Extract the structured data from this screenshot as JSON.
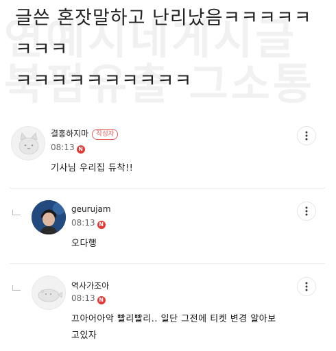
{
  "post": {
    "text": "글쓴 혼잣말하고 난리났음ㅋㅋㅋㅋㅋㅋㅋㅋ\nㅋㅋㅋㅋㅋㅋㅋㅋㅋㅋ",
    "watermark": "연예시네게시글\n북펌유출 그소통"
  },
  "comments": [
    {
      "nickname": "결홍하지마",
      "badge": "작성자",
      "time": "08:13",
      "new_badge": "N",
      "body": "기사님 우리집 듀착!!",
      "avatar": "cat-avatar-icon"
    },
    {
      "nickname": "geurujam",
      "time": "08:13",
      "new_badge": "N",
      "body": "오다행",
      "avatar": "photo-avatar"
    },
    {
      "nickname": "역사가조아",
      "time": "08:13",
      "new_badge": "N",
      "body": "끄아어아악 빨리빨리.. 일단 그전에 티켓 변경 알아보\n고있자",
      "avatar": "seal-avatar-icon"
    }
  ],
  "colors": {
    "new_badge": "#e53935",
    "author_badge": "#e55a5a",
    "divider": "#ececec"
  }
}
